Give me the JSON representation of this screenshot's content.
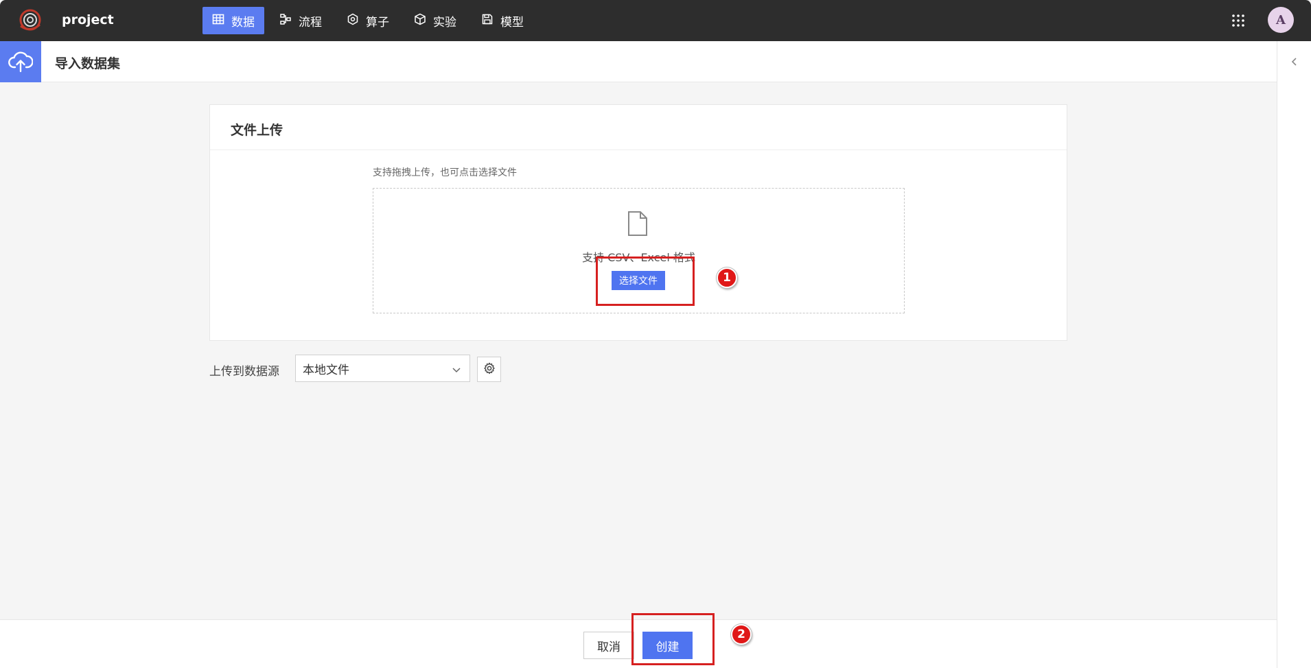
{
  "app": {
    "name": "project"
  },
  "nav": {
    "items": [
      {
        "label": "数据",
        "icon": "table-icon",
        "active": true
      },
      {
        "label": "流程",
        "icon": "flow-icon",
        "active": false
      },
      {
        "label": "算子",
        "icon": "hexagon-icon",
        "active": false
      },
      {
        "label": "实验",
        "icon": "cube-icon",
        "active": false
      },
      {
        "label": "模型",
        "icon": "save-icon",
        "active": false
      }
    ]
  },
  "user": {
    "avatar_initial": "A"
  },
  "page": {
    "title": "导入数据集"
  },
  "upload_card": {
    "title": "文件上传",
    "hint": "支持拖拽上传，也可点击选择文件",
    "dropzone_text": "支持 CSV、Excel 格式",
    "choose_button": "选择文件"
  },
  "datasource": {
    "label": "上传到数据源",
    "selected": "本地文件"
  },
  "footer": {
    "cancel_label": "取消",
    "create_label": "创建"
  },
  "annotations": {
    "marker_1": "1",
    "marker_2": "2"
  },
  "colors": {
    "accent": "#4f74f0",
    "topbar": "#2d2d2d",
    "annotation_red": "#d62020"
  }
}
